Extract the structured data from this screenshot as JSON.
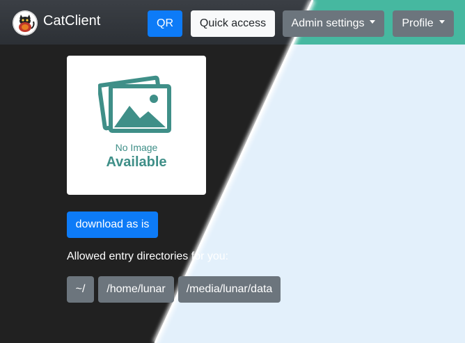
{
  "brand": {
    "name": "CatClient",
    "logo_icon": "cat-logo-icon"
  },
  "navbar": {
    "qr_label": "QR",
    "quick_access_label": "Quick access",
    "admin_settings_label": "Admin settings",
    "profile_label": "Profile"
  },
  "preview": {
    "placeholder_line1": "No Image",
    "placeholder_line2": "Available",
    "placeholder_icon": "image-placeholder-icon"
  },
  "actions": {
    "download_label": "download as is"
  },
  "directories": {
    "label": "Allowed entry directories for you:",
    "items": [
      "~/",
      "/home/lunar",
      "/media/lunar/data"
    ]
  },
  "colors": {
    "primary": "#0d7bf7",
    "secondary": "#6c757d",
    "dark_bg": "#212121",
    "light_bg": "#e3f0fb",
    "navbar_accent": "#46b8a0",
    "placeholder_teal": "#3f8f88"
  }
}
